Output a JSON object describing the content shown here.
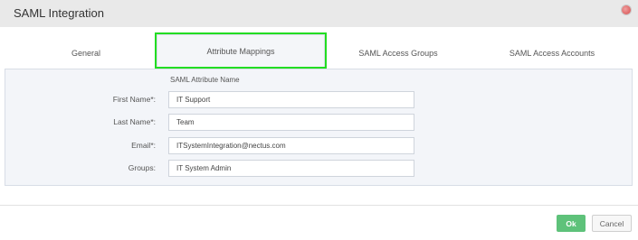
{
  "dialog": {
    "title": "SAML Integration",
    "close_icon": "close-icon"
  },
  "tabs": [
    {
      "label": "General",
      "active": false
    },
    {
      "label": "Attribute Mappings",
      "active": true
    },
    {
      "label": "SAML Access Groups",
      "active": false
    },
    {
      "label": "SAML Access Accounts",
      "active": false
    }
  ],
  "mappings": {
    "column_header": "SAML Attribute Name",
    "rows": [
      {
        "label": "First Name*:",
        "value": "IT Support"
      },
      {
        "label": "Last Name*:",
        "value": "Team"
      },
      {
        "label": "Email*:",
        "value": "ITSystemIntegration@nectus.com"
      },
      {
        "label": "Groups:",
        "value": "IT System Admin"
      }
    ]
  },
  "footer": {
    "ok_label": "Ok",
    "cancel_label": "Cancel"
  },
  "colors": {
    "ok_button": "#5ec27a",
    "active_tab_highlight": "#22dd22",
    "panel_bg": "#f3f5f9",
    "titlebar_bg": "#e9e9e9"
  }
}
